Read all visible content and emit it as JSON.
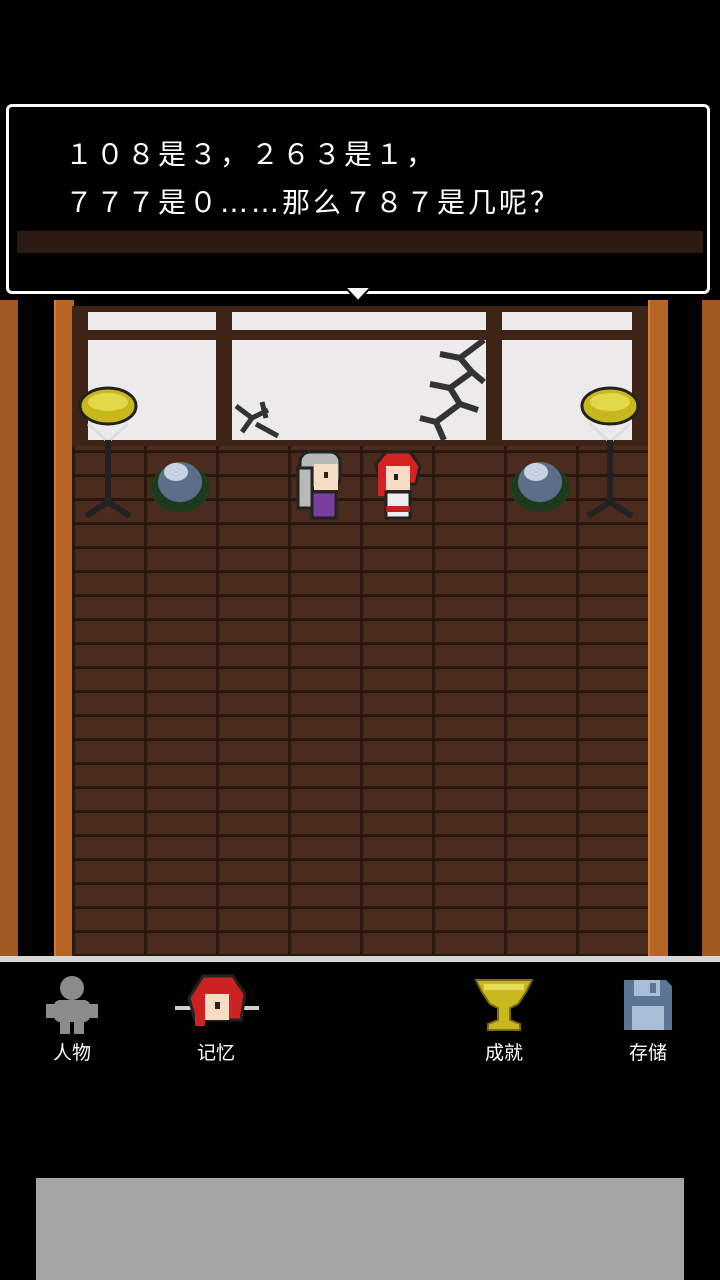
{
  "dialogue": {
    "line1": "１０８是３，２６３是１，",
    "line2": "７７７是０……那么７８７是几呢？"
  },
  "menu": {
    "items": [
      {
        "label": "人物",
        "icon": "person-silhouette-icon"
      },
      {
        "label": "记忆",
        "icon": "red-haired-character-portrait-icon"
      },
      {
        "label": "成就",
        "icon": "trophy-icon"
      },
      {
        "label": "存储",
        "icon": "floppy-disk-icon"
      }
    ]
  },
  "colors": {
    "wall_wood": "#4b2b1d",
    "pillar": "#b76424",
    "window_paper": "#eceaea",
    "trophy_gold": "#c9b81d",
    "floppy_blue": "#5a7596",
    "dialog_border": "#ffffff",
    "ad_gray": "#a6a6a6"
  }
}
